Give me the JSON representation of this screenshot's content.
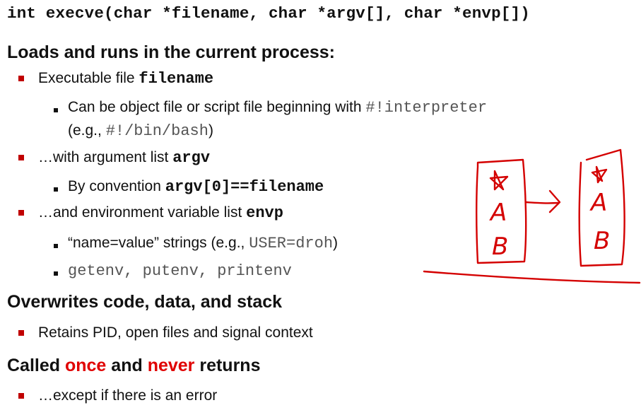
{
  "signature": "int execve(char *filename, char *argv[], char *envp[])",
  "sections": [
    {
      "heading": "Loads and runs in the current process:",
      "items": [
        {
          "text": "Executable  file ",
          "code": "filename",
          "subitems": [
            {
              "text": "Can be object file or script file beginning with ",
              "code": "#!interpreter",
              "line2_prefix": "(e.g., ",
              "line2_code": "#!/bin/bash",
              "line2_suffix": ")"
            }
          ]
        },
        {
          "text": "…with argument list ",
          "code": "argv",
          "subitems": [
            {
              "text": "By convention ",
              "code": "argv[0]==filename"
            }
          ]
        },
        {
          "text": "…and  environment variable list  ",
          "code": "envp",
          "subitems": [
            {
              "text": "“name=value” strings (e.g., ",
              "code": "USER=droh",
              "suffix": ")"
            },
            {
              "code": "getenv, putenv, printenv"
            }
          ]
        }
      ]
    },
    {
      "heading": "Overwrites code, data, and stack",
      "items": [
        {
          "text": "Retains PID, open files and signal context"
        }
      ]
    },
    {
      "heading_parts": [
        "Called ",
        "once",
        " and ",
        "never",
        " returns"
      ],
      "items": [
        {
          "text": "…except if there is an error"
        }
      ]
    }
  ],
  "annotation": {
    "left_box_letters": [
      "A",
      "B"
    ],
    "right_box_letters": [
      "A",
      "B"
    ]
  },
  "colors": {
    "accent": "#e00000",
    "bullet": "#c00000",
    "ink": "#d40000",
    "text": "#111111",
    "code_gray": "#555555"
  }
}
